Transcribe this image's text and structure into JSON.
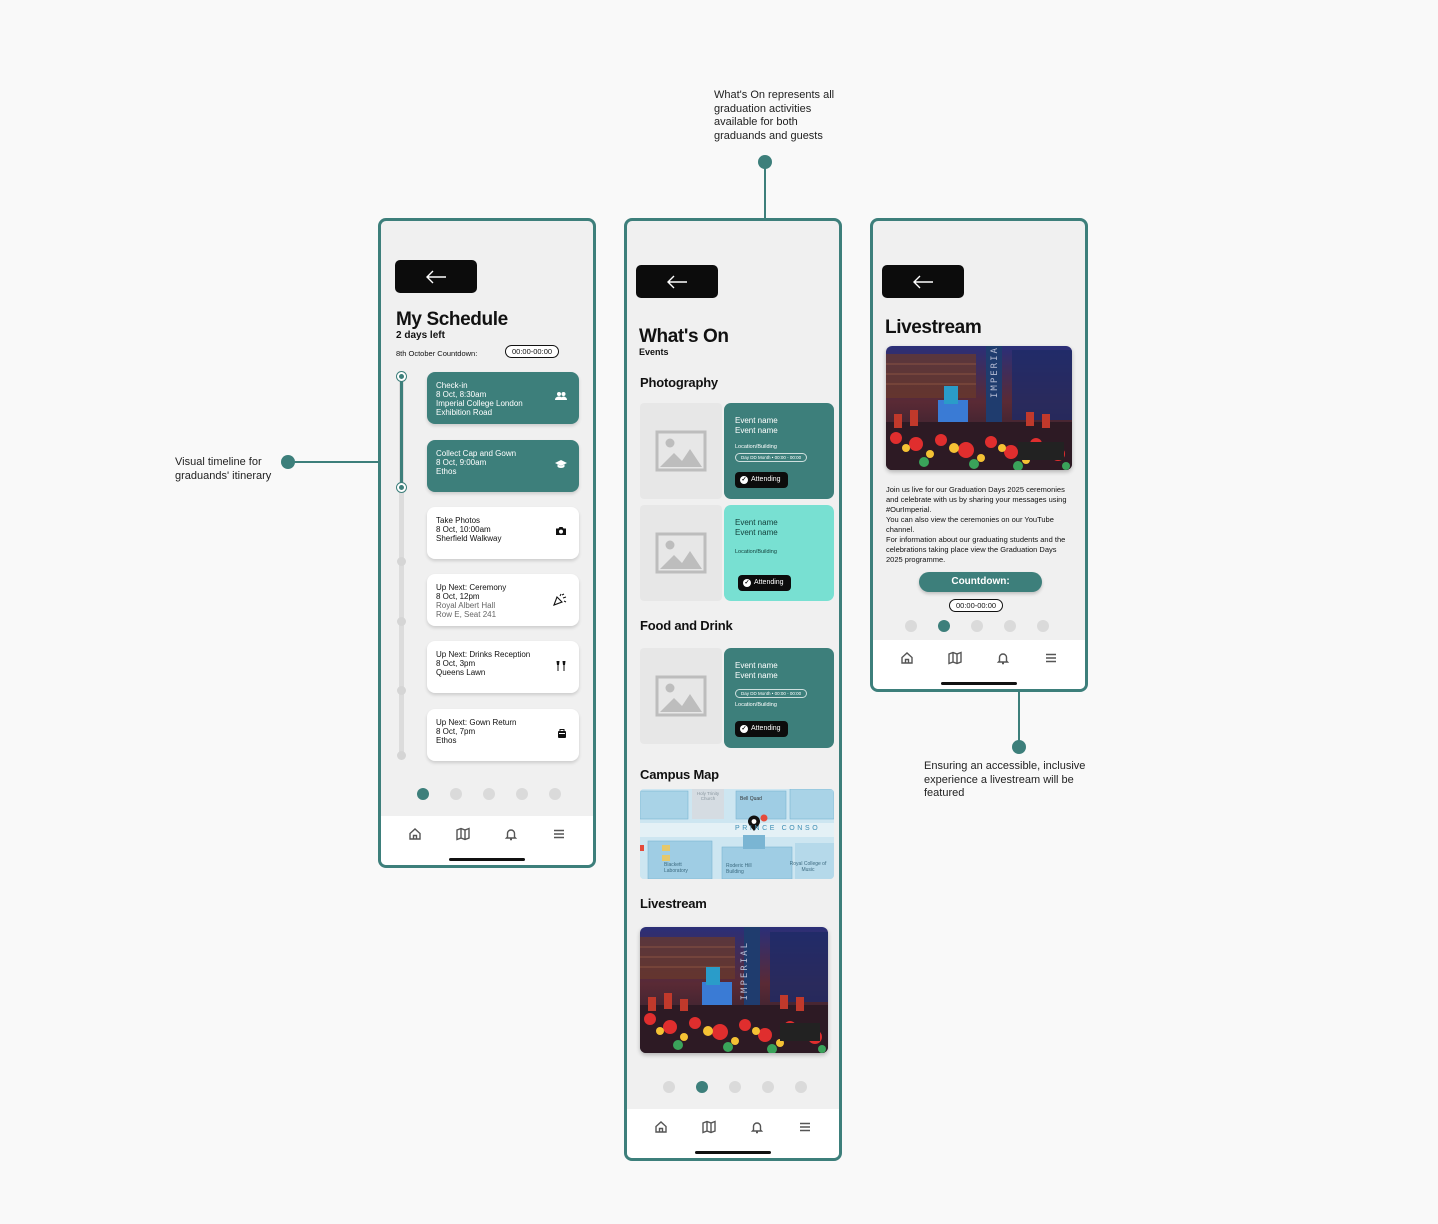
{
  "annotations": {
    "timeline": "Visual timeline for graduands' itinerary",
    "whats_on": "What's On represents all graduation activities available for both graduands and guests",
    "livestream": "Ensuring an accessible, inclusive experience a livestream will be featured"
  },
  "schedule": {
    "title": "My Schedule",
    "days_left": "2 days left",
    "countdown_label": "8th October Countdown:",
    "countdown_value": "00:00-00:00",
    "items": [
      {
        "l1": "Check-in",
        "l2": "8 Oct, 8:30am",
        "l3": "Imperial College London",
        "l4": "Exhibition Road",
        "icon": "people-icon"
      },
      {
        "l1": "Collect Cap and Gown",
        "l2": "8 Oct, 9:00am",
        "l3": "Ethos",
        "l4": "",
        "icon": "graduation-cap-icon"
      },
      {
        "l1": "Take Photos",
        "l2": "8 Oct, 10:00am",
        "l3": "Sherfield Walkway",
        "l4": "",
        "icon": "camera-icon"
      },
      {
        "l1": "Up Next: Ceremony",
        "l2": "8 Oct, 12pm",
        "l3": "Royal Albert Hall",
        "l4": "Row E, Seat 241",
        "icon": "party-popper-icon"
      },
      {
        "l1": "Up Next: Drinks Reception",
        "l2": "8 Oct, 3pm",
        "l3": "Queens Lawn",
        "l4": "",
        "icon": "champagne-icon"
      },
      {
        "l1": "Up Next: Gown Return",
        "l2": "8 Oct, 7pm",
        "l3": "Ethos",
        "l4": "",
        "icon": "bag-icon"
      }
    ]
  },
  "whats_on": {
    "title": "What's On",
    "subtitle": "Events",
    "photography": "Photography",
    "food": "Food and Drink",
    "map": "Campus Map",
    "livestream": "Livestream",
    "event_name": "Event name",
    "location": "Location/Building",
    "date_pill": "Day DD Month • 00:00 - 00:00",
    "attending": "Attending",
    "map_labels": {
      "church": "Holy Trinity Church",
      "quad": "Bell Quad",
      "road": "PRINCE CONSO",
      "blackett": "Blackett Laboratory",
      "roderic": "Roderic Hill Building",
      "rcm": "Royal College of Music"
    }
  },
  "livestream": {
    "title": "Livestream",
    "body": [
      "Join us live for our Graduation Days 2025 ceremonies and celebrate with us by sharing your messages using #OurImperial.",
      "You can also view the ceremonies on our YouTube channel.",
      "For information about our graduating students and the celebrations taking place view the Graduation Days 2025 programme."
    ],
    "countdown_btn": "Countdown:",
    "countdown_value": "00:00-00:00",
    "banner_text": "IMPERIAL"
  },
  "colors": {
    "brand": "#3d7f7b",
    "mint": "#78e0d2"
  }
}
